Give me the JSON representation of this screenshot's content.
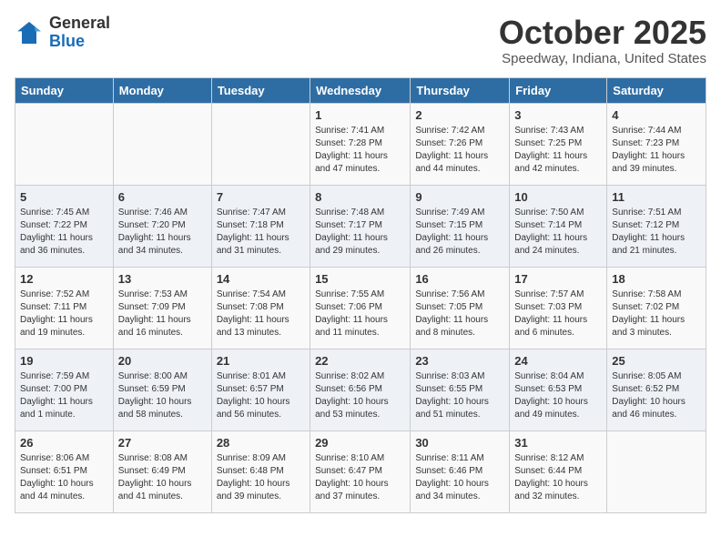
{
  "header": {
    "logo_general": "General",
    "logo_blue": "Blue",
    "month": "October 2025",
    "location": "Speedway, Indiana, United States"
  },
  "days_of_week": [
    "Sunday",
    "Monday",
    "Tuesday",
    "Wednesday",
    "Thursday",
    "Friday",
    "Saturday"
  ],
  "weeks": [
    [
      {
        "day": "",
        "info": ""
      },
      {
        "day": "",
        "info": ""
      },
      {
        "day": "",
        "info": ""
      },
      {
        "day": "1",
        "info": "Sunrise: 7:41 AM\nSunset: 7:28 PM\nDaylight: 11 hours and 47 minutes."
      },
      {
        "day": "2",
        "info": "Sunrise: 7:42 AM\nSunset: 7:26 PM\nDaylight: 11 hours and 44 minutes."
      },
      {
        "day": "3",
        "info": "Sunrise: 7:43 AM\nSunset: 7:25 PM\nDaylight: 11 hours and 42 minutes."
      },
      {
        "day": "4",
        "info": "Sunrise: 7:44 AM\nSunset: 7:23 PM\nDaylight: 11 hours and 39 minutes."
      }
    ],
    [
      {
        "day": "5",
        "info": "Sunrise: 7:45 AM\nSunset: 7:22 PM\nDaylight: 11 hours and 36 minutes."
      },
      {
        "day": "6",
        "info": "Sunrise: 7:46 AM\nSunset: 7:20 PM\nDaylight: 11 hours and 34 minutes."
      },
      {
        "day": "7",
        "info": "Sunrise: 7:47 AM\nSunset: 7:18 PM\nDaylight: 11 hours and 31 minutes."
      },
      {
        "day": "8",
        "info": "Sunrise: 7:48 AM\nSunset: 7:17 PM\nDaylight: 11 hours and 29 minutes."
      },
      {
        "day": "9",
        "info": "Sunrise: 7:49 AM\nSunset: 7:15 PM\nDaylight: 11 hours and 26 minutes."
      },
      {
        "day": "10",
        "info": "Sunrise: 7:50 AM\nSunset: 7:14 PM\nDaylight: 11 hours and 24 minutes."
      },
      {
        "day": "11",
        "info": "Sunrise: 7:51 AM\nSunset: 7:12 PM\nDaylight: 11 hours and 21 minutes."
      }
    ],
    [
      {
        "day": "12",
        "info": "Sunrise: 7:52 AM\nSunset: 7:11 PM\nDaylight: 11 hours and 19 minutes."
      },
      {
        "day": "13",
        "info": "Sunrise: 7:53 AM\nSunset: 7:09 PM\nDaylight: 11 hours and 16 minutes."
      },
      {
        "day": "14",
        "info": "Sunrise: 7:54 AM\nSunset: 7:08 PM\nDaylight: 11 hours and 13 minutes."
      },
      {
        "day": "15",
        "info": "Sunrise: 7:55 AM\nSunset: 7:06 PM\nDaylight: 11 hours and 11 minutes."
      },
      {
        "day": "16",
        "info": "Sunrise: 7:56 AM\nSunset: 7:05 PM\nDaylight: 11 hours and 8 minutes."
      },
      {
        "day": "17",
        "info": "Sunrise: 7:57 AM\nSunset: 7:03 PM\nDaylight: 11 hours and 6 minutes."
      },
      {
        "day": "18",
        "info": "Sunrise: 7:58 AM\nSunset: 7:02 PM\nDaylight: 11 hours and 3 minutes."
      }
    ],
    [
      {
        "day": "19",
        "info": "Sunrise: 7:59 AM\nSunset: 7:00 PM\nDaylight: 11 hours and 1 minute."
      },
      {
        "day": "20",
        "info": "Sunrise: 8:00 AM\nSunset: 6:59 PM\nDaylight: 10 hours and 58 minutes."
      },
      {
        "day": "21",
        "info": "Sunrise: 8:01 AM\nSunset: 6:57 PM\nDaylight: 10 hours and 56 minutes."
      },
      {
        "day": "22",
        "info": "Sunrise: 8:02 AM\nSunset: 6:56 PM\nDaylight: 10 hours and 53 minutes."
      },
      {
        "day": "23",
        "info": "Sunrise: 8:03 AM\nSunset: 6:55 PM\nDaylight: 10 hours and 51 minutes."
      },
      {
        "day": "24",
        "info": "Sunrise: 8:04 AM\nSunset: 6:53 PM\nDaylight: 10 hours and 49 minutes."
      },
      {
        "day": "25",
        "info": "Sunrise: 8:05 AM\nSunset: 6:52 PM\nDaylight: 10 hours and 46 minutes."
      }
    ],
    [
      {
        "day": "26",
        "info": "Sunrise: 8:06 AM\nSunset: 6:51 PM\nDaylight: 10 hours and 44 minutes."
      },
      {
        "day": "27",
        "info": "Sunrise: 8:08 AM\nSunset: 6:49 PM\nDaylight: 10 hours and 41 minutes."
      },
      {
        "day": "28",
        "info": "Sunrise: 8:09 AM\nSunset: 6:48 PM\nDaylight: 10 hours and 39 minutes."
      },
      {
        "day": "29",
        "info": "Sunrise: 8:10 AM\nSunset: 6:47 PM\nDaylight: 10 hours and 37 minutes."
      },
      {
        "day": "30",
        "info": "Sunrise: 8:11 AM\nSunset: 6:46 PM\nDaylight: 10 hours and 34 minutes."
      },
      {
        "day": "31",
        "info": "Sunrise: 8:12 AM\nSunset: 6:44 PM\nDaylight: 10 hours and 32 minutes."
      },
      {
        "day": "",
        "info": ""
      }
    ]
  ]
}
